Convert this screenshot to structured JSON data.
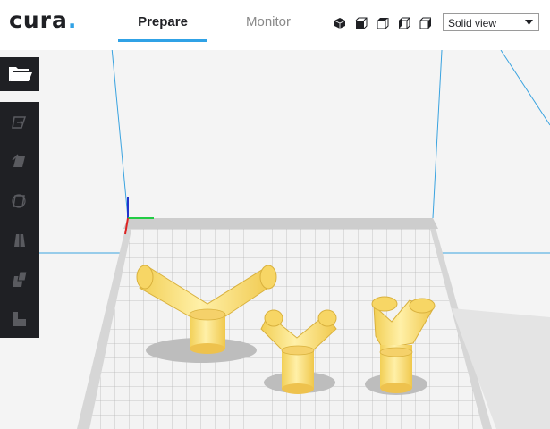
{
  "app": {
    "logo_text": "cura",
    "logo_dot": "."
  },
  "tabs": [
    {
      "label": "Prepare",
      "active": true
    },
    {
      "label": "Monitor",
      "active": false
    }
  ],
  "view_buttons": [
    "view-3d-icon",
    "view-front-icon",
    "view-top-icon",
    "view-left-icon",
    "view-right-icon"
  ],
  "view_mode": {
    "selected": "Solid view"
  },
  "sidebar": {
    "open_file": "folder-open-icon",
    "tools": [
      "translate-icon",
      "scale-icon",
      "rotate-icon",
      "mirror-icon",
      "per-model-settings-icon",
      "support-blocker-icon"
    ]
  },
  "colors": {
    "accent": "#30a2e6",
    "dark": "#1f2024",
    "model": "#ffe07a",
    "build_plate": "#c8c8c8"
  },
  "scene": {
    "models": [
      "y-connector-model",
      "y-connector-model",
      "y-connector-model"
    ]
  }
}
